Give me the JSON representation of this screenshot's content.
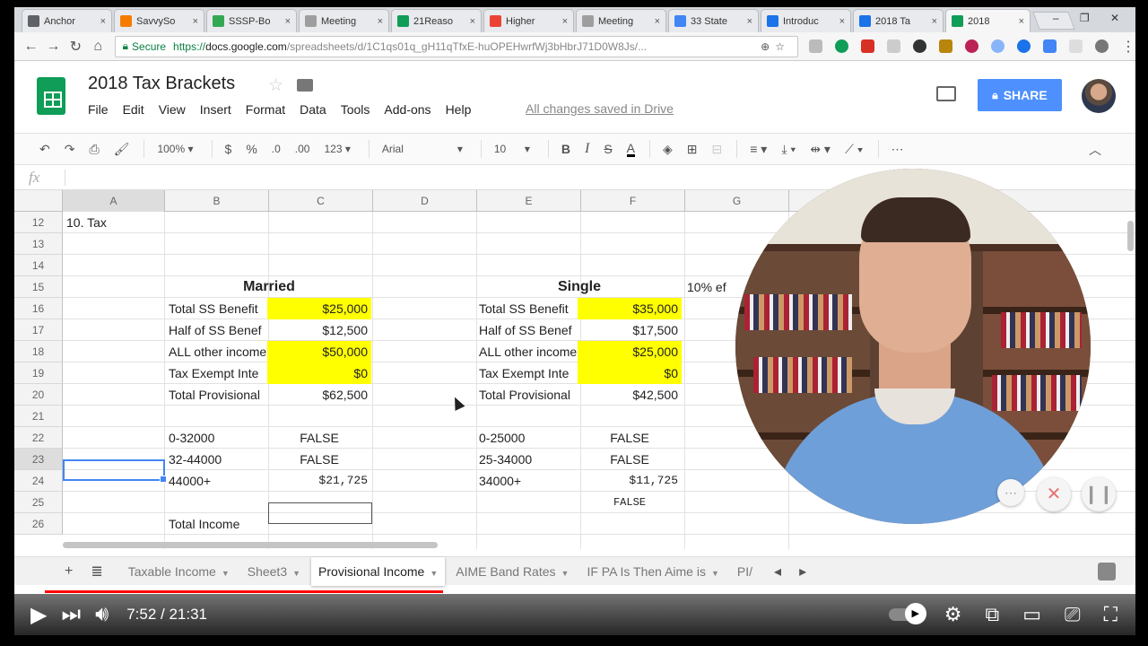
{
  "browser": {
    "tabs": [
      {
        "title": "Anchor",
        "color": "#5f6368"
      },
      {
        "title": "SavvySo",
        "color": "#f57c00"
      },
      {
        "title": "SSSP-Bo",
        "color": "#34a853"
      },
      {
        "title": "Meeting",
        "color": "#9e9e9e"
      },
      {
        "title": "21Reaso",
        "color": "#0f9d58"
      },
      {
        "title": "Higher",
        "color": "#ea4335"
      },
      {
        "title": "Meeting",
        "color": "#9e9e9e"
      },
      {
        "title": "33 State",
        "color": "#4285f4"
      },
      {
        "title": "Introduc",
        "color": "#1a73e8"
      },
      {
        "title": "2018 Ta",
        "color": "#1a73e8"
      },
      {
        "title": "2018",
        "color": "#0f9d58",
        "active": true
      }
    ],
    "close_glyph": "×",
    "window_controls": "‒ ❐ ✕",
    "url": {
      "secure_label": "Secure",
      "scheme": "https://",
      "host": "docs.google.com",
      "path": "/spreadsheets/d/1C1qs01q_gH11qTfxE-huOPEHwrfWj3bHbrJ71D0W8Js/..."
    }
  },
  "sheets": {
    "title": "2018 Tax Brackets",
    "menu": [
      "File",
      "Edit",
      "View",
      "Insert",
      "Format",
      "Data",
      "Tools",
      "Add-ons",
      "Help"
    ],
    "saved_status": "All changes saved in Drive",
    "share_label": "SHARE",
    "toolbar": {
      "zoom": "100%",
      "currency": "$",
      "percent": "%",
      "dec_decrease": ".0",
      "dec_increase": ".00",
      "format_more": "123",
      "font": "Arial",
      "font_size": "10",
      "bold": "B",
      "italic": "I",
      "strike": "S",
      "text_color": "A"
    },
    "fx_label": "fx",
    "columns": [
      "A",
      "B",
      "C",
      "D",
      "E",
      "F",
      "G"
    ],
    "rows": [
      "12",
      "13",
      "14",
      "15",
      "16",
      "17",
      "18",
      "19",
      "20",
      "21",
      "22",
      "23",
      "24",
      "25",
      "26"
    ],
    "cells": {
      "a12": "10. Tax",
      "married": "Married",
      "single": "Single",
      "g15": "10% ef",
      "m_total_ss_label": "Total SS Benefit",
      "m_total_ss": "$25,000",
      "m_half_label": "Half of SS Benef",
      "m_half": "$12,500",
      "m_other_label": "ALL other income",
      "m_other": "$50,000",
      "m_exempt_label": "Tax Exempt Inte",
      "m_exempt": "$0",
      "m_prov_label": "Total Provisional",
      "m_prov": "$62,500",
      "m_b1": "0-32000",
      "m_b1_val": "FALSE",
      "m_b2": "32-44000",
      "m_b2_val": "FALSE",
      "m_b3": "44000+",
      "m_b3_val": "$21,725",
      "total_income": "Total Income",
      "s_total_ss_label": "Total SS Benefit",
      "s_total_ss": "$35,000",
      "s_half_label": "Half of SS Benef",
      "s_half": "$17,500",
      "s_other_label": "ALL other income",
      "s_other": "$25,000",
      "s_exempt_label": "Tax Exempt Inte",
      "s_exempt": "$0",
      "s_prov_label": "Total Provisional",
      "s_prov": "$42,500",
      "s_b1": "0-25000",
      "s_b1_val": "FALSE",
      "s_b2": "25-34000",
      "s_b2_val": "FALSE",
      "s_b3": "34000+",
      "s_b3_val": "$11,725",
      "s_f25": "FALSE"
    },
    "sheet_tabs": [
      {
        "label": "Taxable Income"
      },
      {
        "label": "Sheet3"
      },
      {
        "label": "Provisional Income",
        "active": true
      },
      {
        "label": "AIME Band Rates"
      },
      {
        "label": "IF PA Is Then Aime is"
      },
      {
        "label": "PI/"
      }
    ]
  },
  "player": {
    "current_time": "7:52",
    "duration": "21:31",
    "time_separator": " / ",
    "progress": 0.365,
    "accent": "#ff0000"
  }
}
